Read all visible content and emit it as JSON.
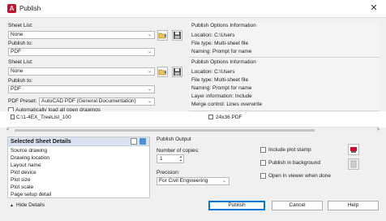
{
  "window": {
    "title": "Publish",
    "close_glyph": "✕"
  },
  "upper": {
    "sheet_list_label": "Sheet List:",
    "sheet_list_value": "None",
    "publish_to_label": "Publish to:",
    "publish_to_value": "PDF"
  },
  "upper_info": {
    "title": "Publish Options Information",
    "lines": [
      "Location: C:\\Users",
      "File type: Multi-sheet file",
      "Naming: Prompt for name"
    ]
  },
  "lower": {
    "sheet_list_label": "Sheet List:",
    "sheet_list_value": "None",
    "publish_to_label": "Publish to:",
    "publish_to_value": "PDF",
    "pdf_preset_label": "PDF Preset:",
    "pdf_preset_value": "AutoCAD PDF (General Documentation)",
    "auto_load_label": "Automatically load all open drawings",
    "sheet_row_name": "C:\\1-4EX_TreeList_100",
    "sheet_row_size": "24x36 PDF"
  },
  "lower_info": {
    "title": "Publish Options Information",
    "lines": [
      "Location: C:\\Users",
      "File type: Multi-sheet file",
      "Naming: Prompt for name",
      "Layer information: Include",
      "Merge control: Lines overwrite"
    ]
  },
  "details": {
    "title": "Selected Sheet Details",
    "rows": [
      "Source drawing",
      "Drawing location",
      "Layout name",
      "Plot device",
      "Plot size",
      "Plot scale",
      "Page setup detail"
    ]
  },
  "output": {
    "title": "Publish Output",
    "copies_label": "Number of copies:",
    "copies_value": "1",
    "precision_label": "Precision:",
    "precision_value": "For Civil Engineering",
    "include_plot_stamp": "Include plot stamp",
    "publish_background": "Publish in background",
    "open_viewer": "Open in viewer when done"
  },
  "footer": {
    "hide_details": "Hide Details",
    "publish": "Publish",
    "cancel": "Cancel",
    "help": "Help"
  },
  "colors": {
    "accent": "#0078d7",
    "brand": "#c8102e",
    "details_header": "#d9e3ef"
  }
}
